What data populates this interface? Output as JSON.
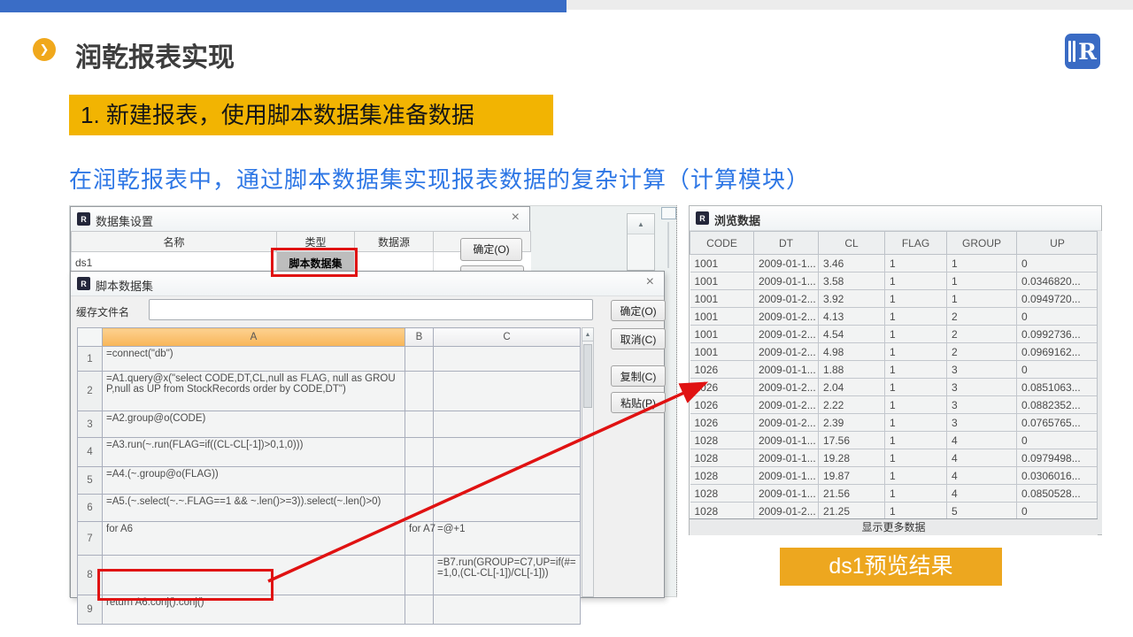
{
  "header": {
    "slide_title": "润乾报表实现",
    "step_title": "1. 新建报表，使用脚本数据集准备数据",
    "description": "在润乾报表中，通过脚本数据集实现报表数据的复杂计算（计算模块）",
    "bullet_glyph": "❯",
    "logo_letter": "R"
  },
  "icons": {
    "dialog_r": "R",
    "up_arrow": "▲"
  },
  "colors": {
    "accent_blue": "#3a6dc6",
    "step_orange": "#f2b402",
    "label_orange": "#eda71f",
    "annotation_red": "#e01212"
  },
  "dataset_dialog": {
    "title": "数据集设置",
    "close_glyph": "×",
    "columns": [
      "名称",
      "类型",
      "数据源"
    ],
    "row_name": "ds1",
    "row_type": "脚本数据集",
    "ok_button": "确定(O)"
  },
  "script_dialog": {
    "title": "脚本数据集",
    "close_glyph": "×",
    "cache_label": "缓存文件名",
    "cache_value": "",
    "buttons": [
      {
        "label": "确定(O)"
      },
      {
        "label": "取消(C)"
      },
      {
        "label": "复制(C)"
      },
      {
        "label": "粘贴(P)"
      }
    ],
    "grid_columns": [
      "A",
      "B",
      "C"
    ],
    "grid_rows": [
      {
        "n": "1",
        "a": "=connect(\"db\")",
        "b": "",
        "c": ""
      },
      {
        "n": "2",
        "a": "=A1.query@x(\"select CODE,DT,CL,null as FLAG, null as GROUP,null as UP from StockRecords order by CODE,DT\")",
        "b": "",
        "c": ""
      },
      {
        "n": "3",
        "a": "=A2.group@o(CODE)",
        "b": "",
        "c": ""
      },
      {
        "n": "4",
        "a": "=A3.run(~.run(FLAG=if((CL-CL[-1])>0,1,0)))",
        "b": "",
        "c": ""
      },
      {
        "n": "5",
        "a": "=A4.(~.group@o(FLAG))",
        "b": "",
        "c": ""
      },
      {
        "n": "6",
        "a": "=A5.(~.select(~.~.FLAG==1 && ~.len()>=3)).select(~.len()>0)",
        "b": "",
        "c": ""
      },
      {
        "n": "7",
        "a": "for A6",
        "b": "for A7",
        "c": "=@+1"
      },
      {
        "n": "8",
        "a": "",
        "b": "",
        "c": "=B7.run(GROUP=C7,UP=if(#==1,0,(CL-CL[-1])/CL[-1]))"
      },
      {
        "n": "9",
        "a": "return A6.conj().conj()",
        "b": "",
        "c": ""
      }
    ]
  },
  "browse_dialog": {
    "title": "浏览数据",
    "columns": [
      "CODE",
      "DT",
      "CL",
      "FLAG",
      "GROUP",
      "UP"
    ],
    "rows": [
      {
        "code": "1001",
        "dt": "2009-01-1...",
        "cl": "3.46",
        "flag": "1",
        "group": "1",
        "up": "0"
      },
      {
        "code": "1001",
        "dt": "2009-01-1...",
        "cl": "3.58",
        "flag": "1",
        "group": "1",
        "up": "0.0346820..."
      },
      {
        "code": "1001",
        "dt": "2009-01-2...",
        "cl": "3.92",
        "flag": "1",
        "group": "1",
        "up": "0.0949720..."
      },
      {
        "code": "1001",
        "dt": "2009-01-2...",
        "cl": "4.13",
        "flag": "1",
        "group": "2",
        "up": "0"
      },
      {
        "code": "1001",
        "dt": "2009-01-2...",
        "cl": "4.54",
        "flag": "1",
        "group": "2",
        "up": "0.0992736..."
      },
      {
        "code": "1001",
        "dt": "2009-01-2...",
        "cl": "4.98",
        "flag": "1",
        "group": "2",
        "up": "0.0969162..."
      },
      {
        "code": "1026",
        "dt": "2009-01-1...",
        "cl": "1.88",
        "flag": "1",
        "group": "3",
        "up": "0"
      },
      {
        "code": "1026",
        "dt": "2009-01-2...",
        "cl": "2.04",
        "flag": "1",
        "group": "3",
        "up": "0.0851063..."
      },
      {
        "code": "1026",
        "dt": "2009-01-2...",
        "cl": "2.22",
        "flag": "1",
        "group": "3",
        "up": "0.0882352..."
      },
      {
        "code": "1026",
        "dt": "2009-01-2...",
        "cl": "2.39",
        "flag": "1",
        "group": "3",
        "up": "0.0765765..."
      },
      {
        "code": "1028",
        "dt": "2009-01-1...",
        "cl": "17.56",
        "flag": "1",
        "group": "4",
        "up": "0"
      },
      {
        "code": "1028",
        "dt": "2009-01-1...",
        "cl": "19.28",
        "flag": "1",
        "group": "4",
        "up": "0.0979498..."
      },
      {
        "code": "1028",
        "dt": "2009-01-1...",
        "cl": "19.87",
        "flag": "1",
        "group": "4",
        "up": "0.0306016..."
      },
      {
        "code": "1028",
        "dt": "2009-01-1...",
        "cl": "21.56",
        "flag": "1",
        "group": "4",
        "up": "0.0850528..."
      },
      {
        "code": "1028",
        "dt": "2009-01-2...",
        "cl": "21.25",
        "flag": "1",
        "group": "5",
        "up": "0"
      }
    ],
    "footer": "显示更多数据"
  },
  "annotations": {
    "result_label": "ds1预览结果"
  }
}
